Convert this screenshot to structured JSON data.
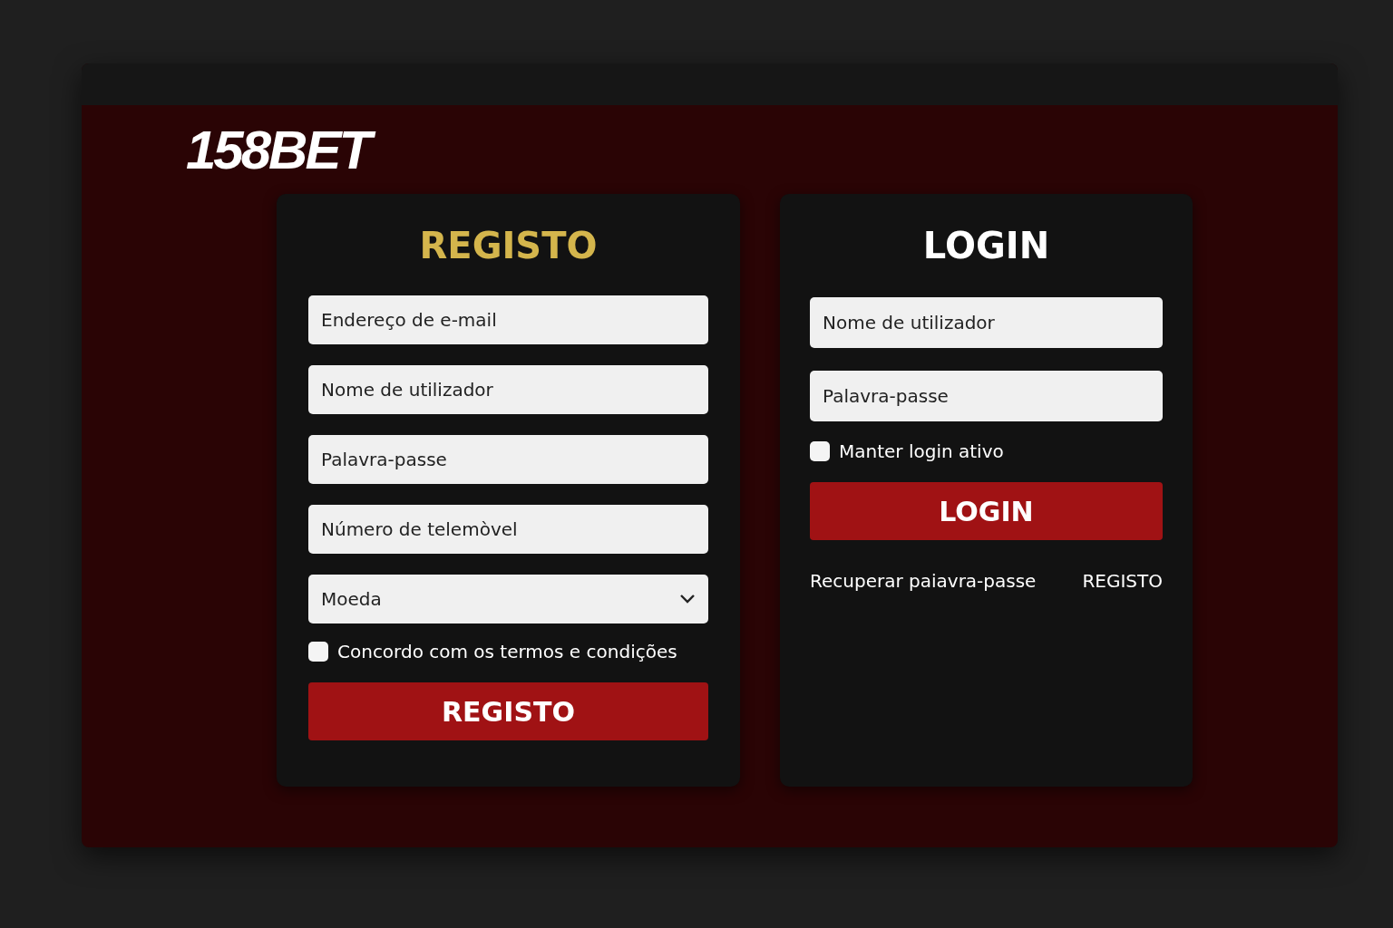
{
  "logo": "158BET",
  "register": {
    "title": "REGISTO",
    "fields": [
      {
        "kind": "text",
        "placeholder": "Endereço de e-mail"
      },
      {
        "kind": "text",
        "placeholder": "Nome de utilizador"
      },
      {
        "kind": "text",
        "placeholder": "Palavra-passe"
      },
      {
        "kind": "text",
        "placeholder": "Número de telemòvel"
      },
      {
        "kind": "select",
        "placeholder": "Moeda"
      }
    ],
    "terms": {
      "label": "Concordo com os termos e condições",
      "checked": false
    },
    "button": "REGISTO"
  },
  "login": {
    "title": "LOGIN",
    "fields": [
      {
        "kind": "text",
        "placeholder": "Nome de utilizador"
      },
      {
        "kind": "text",
        "placeholder": "Palavra-passe"
      }
    ],
    "remember": {
      "label": "Manter login ativo",
      "checked": false
    },
    "button": "LOGIN",
    "links": [
      "Recuperar paiavra-passe",
      "REGISTO"
    ]
  }
}
